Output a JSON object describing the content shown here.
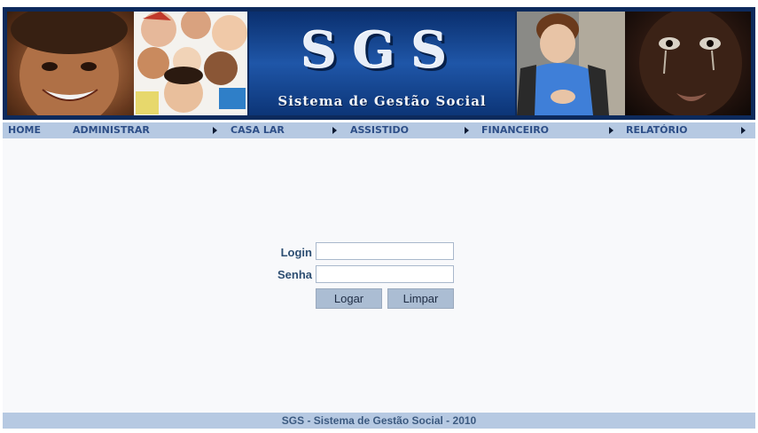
{
  "header": {
    "logo_letters": "SGS",
    "logo_subtitle": "Sistema de Gestão Social"
  },
  "nav": {
    "items": [
      {
        "label": "HOME",
        "has_submenu": false
      },
      {
        "label": "ADMINISTRAR",
        "has_submenu": true
      },
      {
        "label": "CASA LAR",
        "has_submenu": true
      },
      {
        "label": "ASSISTIDO",
        "has_submenu": true
      },
      {
        "label": "FINANCEIRO",
        "has_submenu": true
      },
      {
        "label": "RELATÓRIO",
        "has_submenu": true
      }
    ]
  },
  "login_form": {
    "login_label": "Login",
    "login_value": "",
    "password_label": "Senha",
    "password_value": "",
    "submit_label": "Logar",
    "clear_label": "Limpar"
  },
  "footer": {
    "text": "SGS - Sistema de Gestão Social - 2010"
  },
  "colors": {
    "nav_background": "#b6c9e2",
    "nav_text": "#2d4e87",
    "banner_blue": "#0d2a5c",
    "button_background": "#abbdd3",
    "main_background": "#f8f9fb"
  }
}
